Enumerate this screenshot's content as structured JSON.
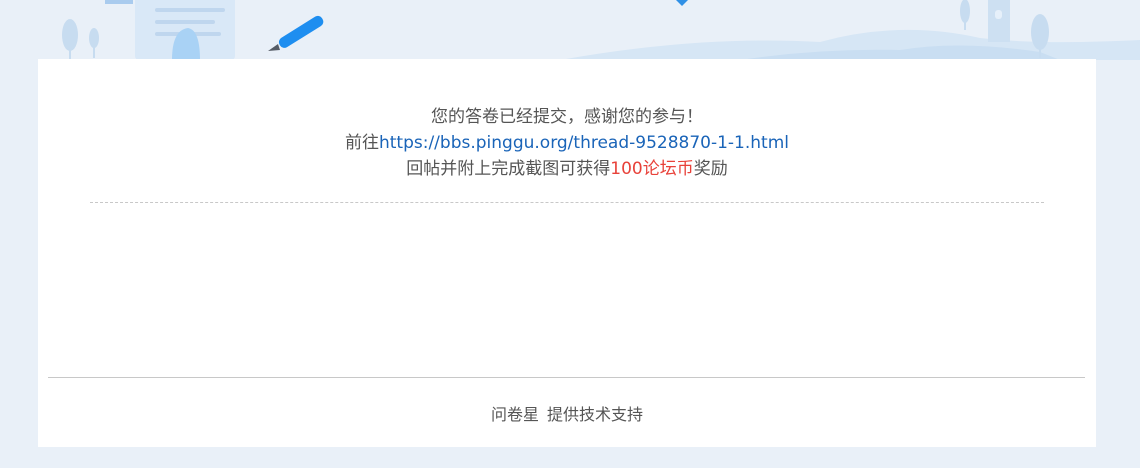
{
  "confirmation": {
    "thanks_text": "您的答卷已经提交，感谢您的参与！",
    "goto_prefix": "前往",
    "thread_link": "https://bbs.pinggu.org/thread-9528870-1-1.html",
    "reward_prefix": "回帖并附上完成截图可获得",
    "reward_amount": "100论坛币",
    "reward_suffix": "奖励"
  },
  "footer": {
    "brand": "问卷星",
    "support_text": "提供技术支持"
  },
  "colors": {
    "page_background": "#e9f0f8",
    "link": "#1a64b8",
    "reward_highlight": "#e8423a"
  },
  "icons": [
    "survey-paper-illustration",
    "pencil-icon",
    "tree-icon",
    "lighthouse-icon"
  ]
}
